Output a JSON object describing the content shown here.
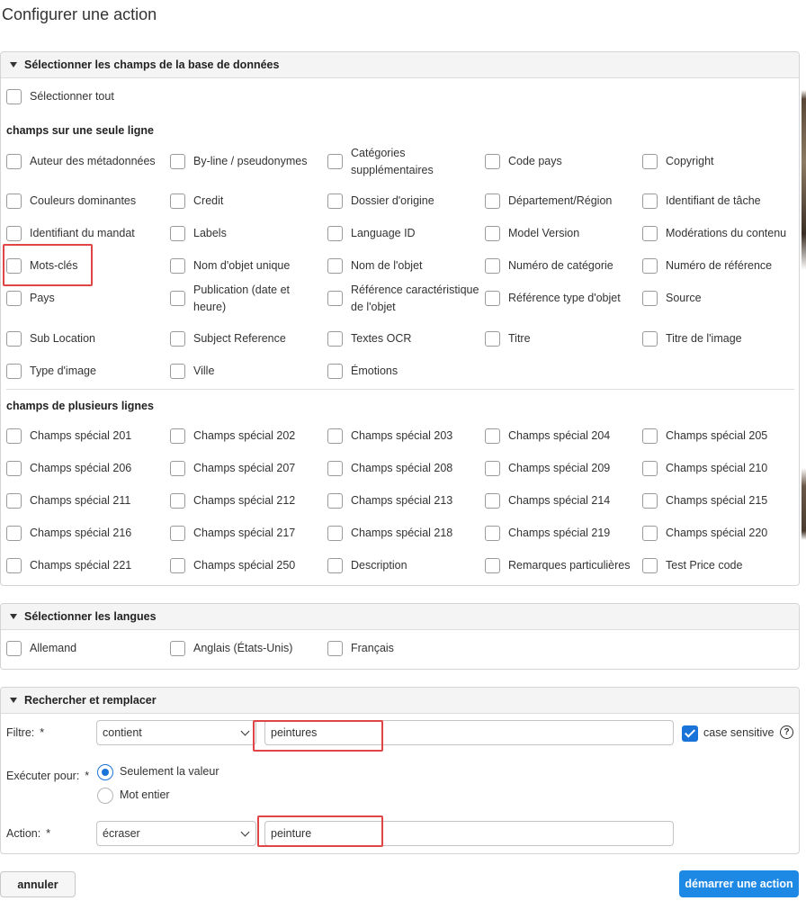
{
  "title": "Configurer une action",
  "fields_panel": {
    "header": "Sélectionner les champs de la base de données",
    "select_all": "Sélectionner tout",
    "single_line_label": "champs sur une seule ligne",
    "single_line": [
      "Auteur des métadonnées",
      "By-line / pseudonymes",
      "Catégories supplémentaires",
      "Code pays",
      "Copyright",
      "Couleurs dominantes",
      "Credit",
      "Dossier d'origine",
      "Département/Région",
      "Identifiant de tâche",
      "Identifiant du mandat",
      "Labels",
      "Language ID",
      "Model Version",
      "Modérations du contenu",
      "Mots-clés",
      "Nom d'objet unique",
      "Nom de l'objet",
      "Numéro de catégorie",
      "Numéro de référence",
      "Pays",
      "Publication (date et heure)",
      "Référence caractéristique de l'objet",
      "Référence type d'objet",
      "Source",
      "Sub Location",
      "Subject Reference",
      "Textes OCR",
      "Titre",
      "Titre de l'image",
      "Type d'image",
      "Ville",
      "Émotions"
    ],
    "multi_line_label": "champs de plusieurs lignes",
    "multi_line": [
      "Champs spécial 201",
      "Champs spécial 202",
      "Champs spécial 203",
      "Champs spécial 204",
      "Champs spécial 205",
      "Champs spécial 206",
      "Champs spécial 207",
      "Champs spécial 208",
      "Champs spécial 209",
      "Champs spécial 210",
      "Champs spécial 211",
      "Champs spécial 212",
      "Champs spécial 213",
      "Champs spécial 214",
      "Champs spécial 215",
      "Champs spécial 216",
      "Champs spécial 217",
      "Champs spécial 218",
      "Champs spécial 219",
      "Champs spécial 220",
      "Champs spécial 221",
      "Champs spécial 250",
      "Description",
      "Remarques particulières",
      "Test Price code"
    ]
  },
  "languages_panel": {
    "header": "Sélectionner les langues",
    "items": [
      "Allemand",
      "Anglais (États-Unis)",
      "Français"
    ]
  },
  "replace_panel": {
    "header": "Rechercher et remplacer",
    "filter_label": "Filtre:",
    "filter_select": "contient",
    "filter_value": "peintures",
    "case_sensitive": "case sensitive",
    "help_glyph": "?",
    "execute_label": "Exécuter pour:",
    "radio_value": "Seulement la valeur",
    "radio_word": "Mot entier",
    "action_label": "Action:",
    "action_select": "écraser",
    "action_value": "peinture",
    "required_mark": "*"
  },
  "buttons": {
    "cancel": "annuler",
    "start": "démarrer une action"
  }
}
